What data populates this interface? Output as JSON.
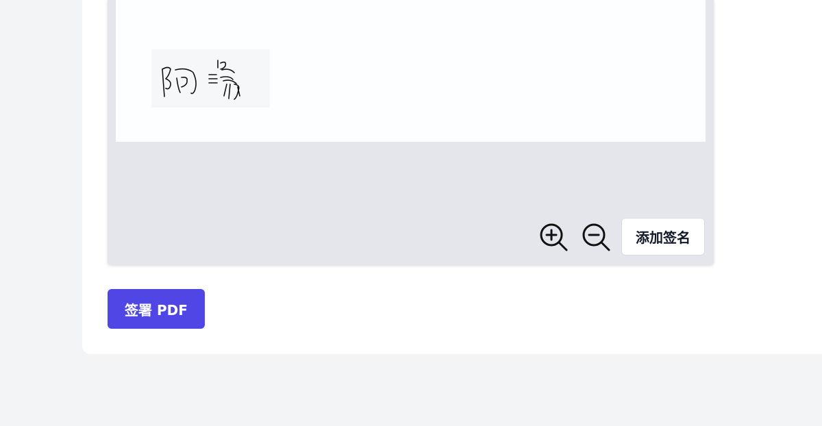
{
  "viewer": {
    "zoom_in_icon": "zoom-in-icon",
    "zoom_out_icon": "zoom-out-icon",
    "add_signature_label": "添加签名"
  },
  "signature": {
    "text": "阿瑒"
  },
  "actions": {
    "sign_pdf_label": "签署 PDF",
    "primary_color": "#4f46e5"
  }
}
